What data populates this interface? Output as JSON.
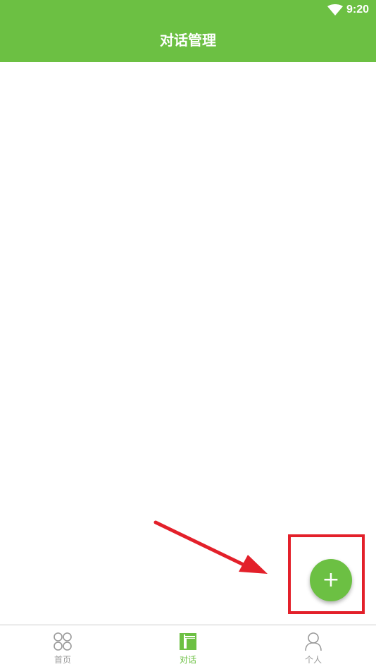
{
  "status_bar": {
    "time": "9:20",
    "wifi_icon": "wifi-icon"
  },
  "header": {
    "title": "对话管理"
  },
  "fab": {
    "label": "+",
    "icon": "plus-icon"
  },
  "annotation": {
    "color": "#e3202a"
  },
  "bottom_nav": {
    "items": [
      {
        "label": "首页",
        "icon": "home-grid-icon",
        "active": false
      },
      {
        "label": "对话",
        "icon": "dialog-layout-icon",
        "active": true
      },
      {
        "label": "个人",
        "icon": "person-icon",
        "active": false
      }
    ]
  },
  "colors": {
    "primary": "#6cc043",
    "inactive": "#999999",
    "annotation": "#e3202a"
  }
}
